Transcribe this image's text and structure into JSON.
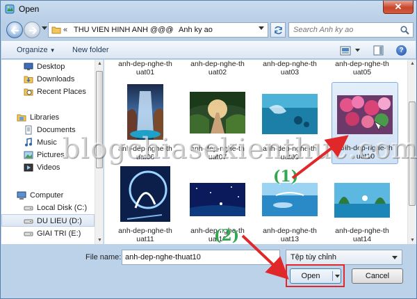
{
  "window": {
    "title": "Open"
  },
  "address": {
    "prefix": "«",
    "segments": [
      "THU VIEN HINH ANH @@@",
      "Anh ky ao"
    ],
    "separator": "›"
  },
  "search": {
    "placeholder": "Search Anh ky ao"
  },
  "toolbar": {
    "organize": "Organize",
    "new_folder": "New folder",
    "help": "?"
  },
  "nav": {
    "items": [
      {
        "label": "Desktop",
        "icon": "desktop-icon",
        "selected": false
      },
      {
        "label": "Downloads",
        "icon": "downloads-icon",
        "selected": false
      },
      {
        "label": "Recent Places",
        "icon": "recent-places-icon",
        "selected": false
      },
      {
        "label": "Libraries",
        "icon": "libraries-icon",
        "selected": false
      },
      {
        "label": "Documents",
        "icon": "documents-icon",
        "selected": false
      },
      {
        "label": "Music",
        "icon": "music-icon",
        "selected": false
      },
      {
        "label": "Pictures",
        "icon": "pictures-icon",
        "selected": false
      },
      {
        "label": "Videos",
        "icon": "videos-icon",
        "selected": false
      },
      {
        "label": "Computer",
        "icon": "computer-icon",
        "selected": false
      },
      {
        "label": "Local Disk (C:)",
        "icon": "drive-icon",
        "selected": false
      },
      {
        "label": "DU LIEU (D:)",
        "icon": "drive-icon",
        "selected": true
      },
      {
        "label": "GIAI TRI (E:)",
        "icon": "drive-icon",
        "selected": false
      }
    ]
  },
  "files": [
    {
      "name": "anh-dep-nghe-thuat01",
      "visible_name": "anh-dep-nghe-th\nuat01",
      "selected": false
    },
    {
      "name": "anh-dep-nghe-thuat02",
      "visible_name": "anh-dep-nghe-th\nuat02",
      "selected": false
    },
    {
      "name": "anh-dep-nghe-thuat03",
      "visible_name": "anh-dep-nghe-th\nuat03",
      "selected": false
    },
    {
      "name": "anh-dep-nghe-thuat05",
      "visible_name": "anh-dep-nghe-th\nuat05",
      "selected": false
    },
    {
      "name": "anh-dep-nghe-thuat06",
      "visible_name": "anh-dep-nghe-th\nuat06",
      "selected": false
    },
    {
      "name": "anh-dep-nghe-thuat07",
      "visible_name": "anh-dep-nghe-th\nuat07",
      "selected": false
    },
    {
      "name": "anh-dep-nghe-thuat09",
      "visible_name": "anh-dep-nghe-th\nuat09",
      "selected": false
    },
    {
      "name": "anh-dep-nghe-thuat10",
      "visible_name": "anh-dep-nghe-th\nuat10",
      "selected": true
    },
    {
      "name": "anh-dep-nghe-thuat11",
      "visible_name": "anh-dep-nghe-th\nuat11",
      "selected": false
    },
    {
      "name": "anh-dep-nghe-thuat12",
      "visible_name": "anh-dep-nghe-th\nuat12",
      "selected": false
    },
    {
      "name": "anh-dep-nghe-thuat13",
      "visible_name": "anh-dep-nghe-th\nuat13",
      "selected": false
    },
    {
      "name": "anh-dep-nghe-thuat14",
      "visible_name": "anh-dep-nghe-th\nuat14",
      "selected": false
    }
  ],
  "bottom": {
    "file_name_label": "File name:",
    "file_name_value": "anh-dep-nghe-thuat10",
    "file_type_value": "Tệp tùy chỉnh",
    "open_label": "Open",
    "cancel_label": "Cancel"
  },
  "overlay": {
    "watermark": "blogchiasekienthuc.com",
    "step1": "(1)",
    "step2": "(2)",
    "annotation_color": "#e0282a",
    "step_color": "#2fa84f"
  },
  "colors": {
    "accent": "#3c7fb1",
    "selection": "#cfe1f5",
    "close": "#c7462c"
  }
}
